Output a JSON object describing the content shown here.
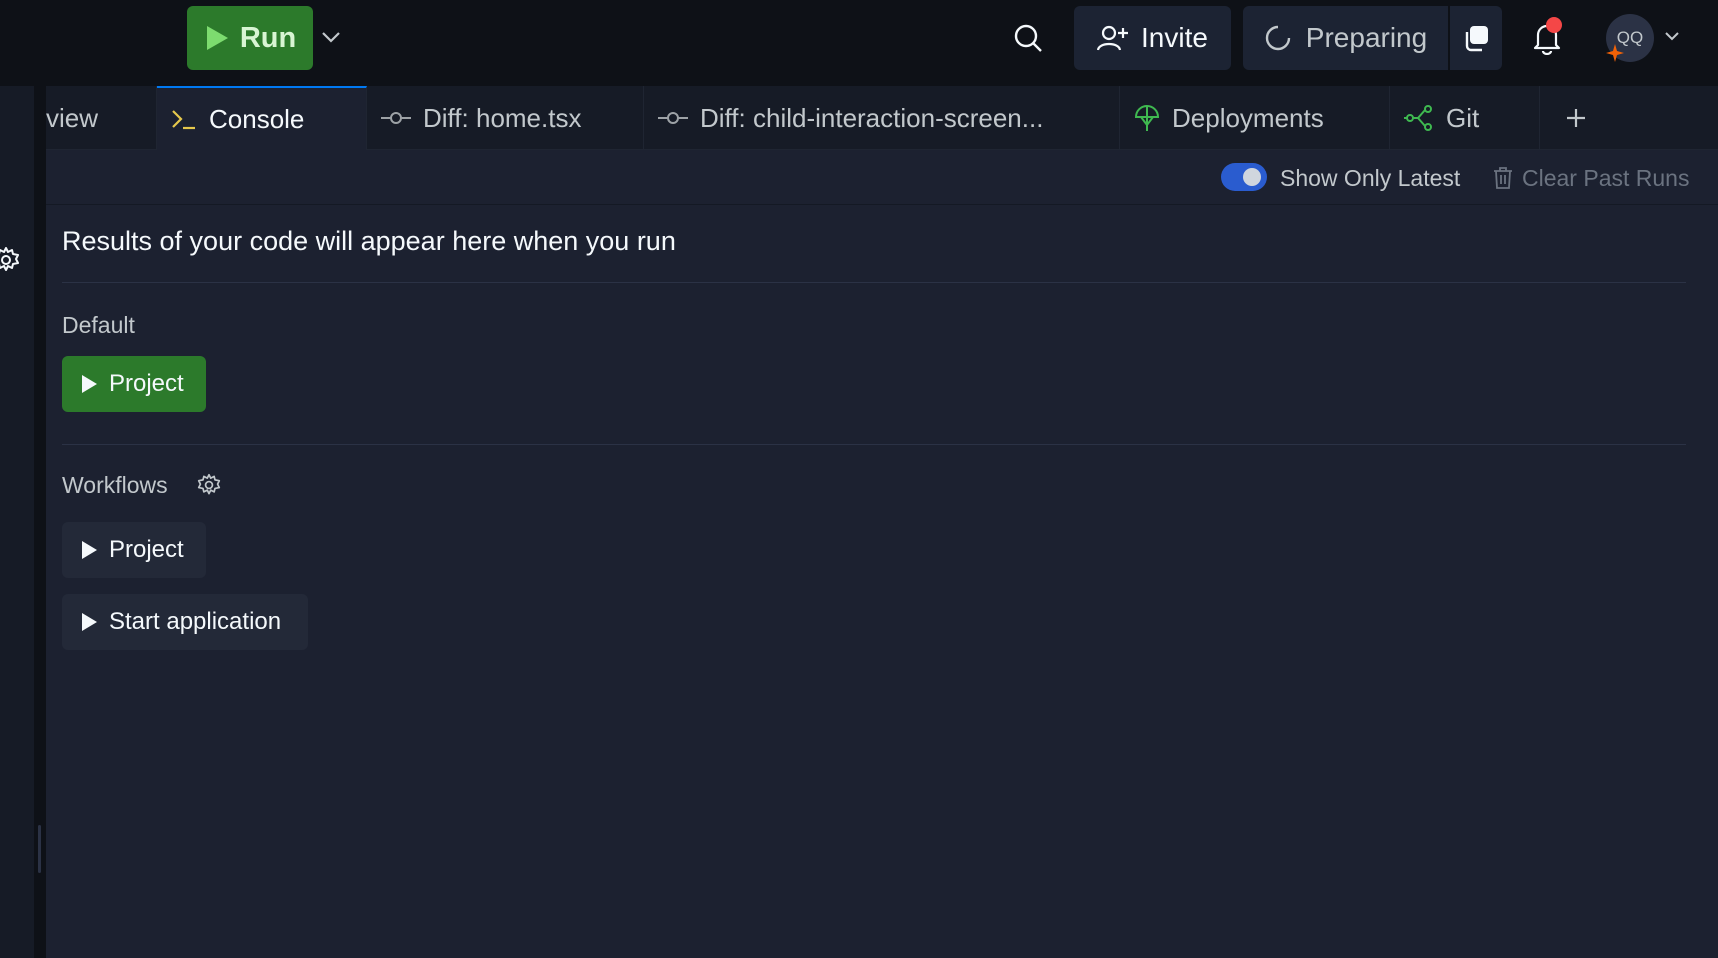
{
  "topbar": {
    "run_label": "Run",
    "invite_label": "Invite",
    "preparing_label": "Preparing",
    "avatar_initials": "QQ"
  },
  "tabs": [
    {
      "label": "view",
      "icon": "none",
      "active": false
    },
    {
      "label": "Console",
      "icon": "terminal-prompt-icon",
      "active": true
    },
    {
      "label": "Diff: home.tsx",
      "icon": "git-commit-icon",
      "active": false
    },
    {
      "label": "Diff: child-interaction-screen...",
      "icon": "git-commit-icon",
      "active": false
    },
    {
      "label": "Deployments",
      "icon": "deployments-icon",
      "active": false
    },
    {
      "label": "Git",
      "icon": "git-branch-icon",
      "active": false
    }
  ],
  "toolbar": {
    "show_only_latest_label": "Show Only Latest",
    "show_only_latest_on": true,
    "clear_past_runs_label": "Clear Past Runs"
  },
  "console": {
    "results_text": "Results of your code will appear here when you run",
    "default_label": "Default",
    "default_items": [
      {
        "label": "Project"
      }
    ],
    "workflows_label": "Workflows",
    "workflow_items": [
      {
        "label": "Project"
      },
      {
        "label": "Start application"
      }
    ]
  },
  "colors": {
    "run_green": "#2c7a2b",
    "toggle_blue": "#2a5ccf",
    "notification_red": "#f44747",
    "active_tab_accent": "#0079f2"
  }
}
